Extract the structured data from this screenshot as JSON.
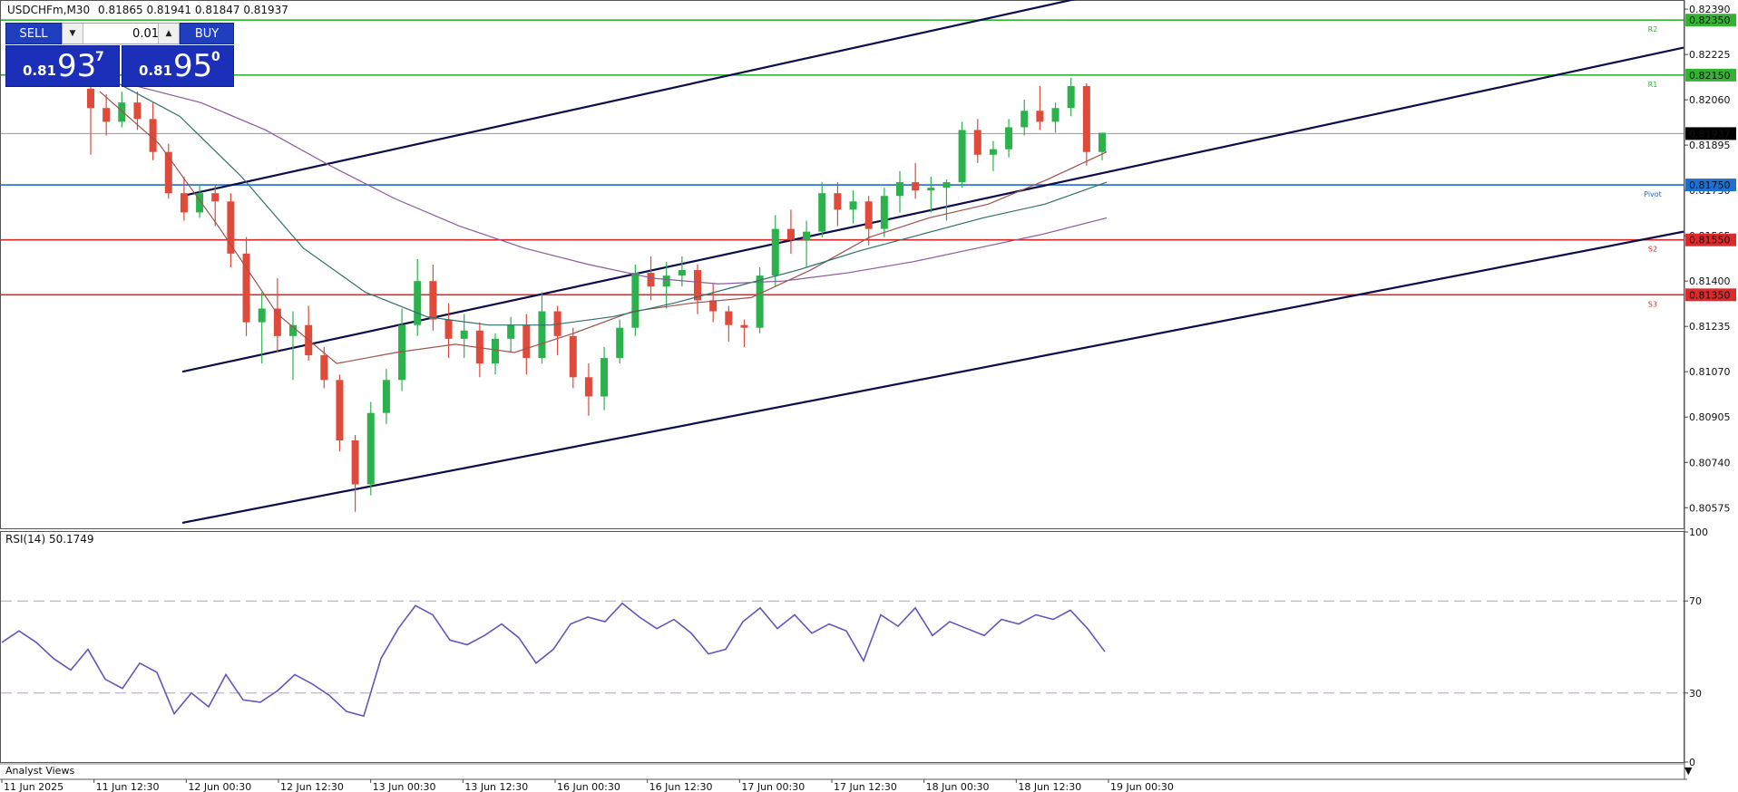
{
  "header": {
    "symbol_info": "USDCHFm,M30",
    "ohlc": "0.81865 0.81941 0.81847 0.81937"
  },
  "trade_panel": {
    "sell_label": "SELL",
    "buy_label": "BUY",
    "lot_value": "0.01",
    "sell_quote": {
      "prefix": "0.81",
      "big": "93",
      "sup": "7"
    },
    "buy_quote": {
      "prefix": "0.81",
      "big": "95",
      "sup": "0"
    }
  },
  "chart_data": [
    {
      "type": "candlestick",
      "title": "USDCHFm,M30",
      "y_ticks": [
        "0.82390",
        "0.82225",
        "0.82060",
        "0.81895",
        "0.81730",
        "0.81565",
        "0.81400",
        "0.81235",
        "0.81070",
        "0.80905",
        "0.80740",
        "0.80575"
      ],
      "ylim": [
        0.805,
        0.8242
      ],
      "x_tick_labels": [
        "11 Jun 2025",
        "11 Jun 12:30",
        "12 Jun 00:30",
        "12 Jun 12:30",
        "13 Jun 00:30",
        "13 Jun 12:30",
        "16 Jun 00:30",
        "16 Jun 12:30",
        "17 Jun 00:30",
        "17 Jun 12:30",
        "18 Jun 00:30",
        "18 Jun 12:30",
        "19 Jun 00:30"
      ],
      "current_price": {
        "value": 0.81937,
        "label": "0.81937",
        "color": "#000000"
      },
      "pivot_levels": [
        {
          "name": "R2",
          "value": 0.8235,
          "label": "0.82350",
          "color": "#33b233"
        },
        {
          "name": "R1",
          "value": 0.8215,
          "label": "0.82150",
          "color": "#33b233"
        },
        {
          "name": "Pivot",
          "value": 0.8175,
          "label": "0.81750",
          "color": "#1e6fd0"
        },
        {
          "name": "S2",
          "value": 0.8155,
          "label": "0.81550",
          "color": "#d92b2b"
        },
        {
          "name": "S3",
          "value": 0.8135,
          "label": "0.81350",
          "color": "#d92b2b"
        }
      ],
      "trend_channel": [
        {
          "from": {
            "x": 0.172,
            "y": 0.8171
          },
          "to": {
            "x": 0.641,
            "y": 0.8243
          }
        },
        {
          "from": {
            "x": 0.172,
            "y": 0.8107
          },
          "to": {
            "x": 1.0,
            "y": 0.8225
          }
        },
        {
          "from": {
            "x": 0.172,
            "y": 0.8052
          },
          "to": {
            "x": 1.0,
            "y": 0.8158
          }
        }
      ],
      "candles": [
        [
          0.821,
          0.8218,
          0.8186,
          0.8203
        ],
        [
          0.8203,
          0.8208,
          0.8193,
          0.8198
        ],
        [
          0.8198,
          0.8209,
          0.8196,
          0.8205
        ],
        [
          0.8205,
          0.8209,
          0.8195,
          0.8199
        ],
        [
          0.8199,
          0.8205,
          0.8184,
          0.8187
        ],
        [
          0.8187,
          0.819,
          0.817,
          0.8172
        ],
        [
          0.8172,
          0.8178,
          0.8162,
          0.8165
        ],
        [
          0.8165,
          0.8175,
          0.8163,
          0.8172
        ],
        [
          0.8172,
          0.8175,
          0.816,
          0.8169
        ],
        [
          0.8169,
          0.8172,
          0.8145,
          0.815
        ],
        [
          0.815,
          0.8156,
          0.812,
          0.8125
        ],
        [
          0.8125,
          0.8136,
          0.811,
          0.813
        ],
        [
          0.813,
          0.8141,
          0.8114,
          0.812
        ],
        [
          0.812,
          0.8129,
          0.8104,
          0.8124
        ],
        [
          0.8124,
          0.8131,
          0.8111,
          0.8113
        ],
        [
          0.8113,
          0.8116,
          0.8101,
          0.8104
        ],
        [
          0.8104,
          0.8106,
          0.8078,
          0.8082
        ],
        [
          0.8082,
          0.8084,
          0.8056,
          0.8066
        ],
        [
          0.8066,
          0.8096,
          0.8062,
          0.8092
        ],
        [
          0.8092,
          0.8108,
          0.8088,
          0.8104
        ],
        [
          0.8104,
          0.813,
          0.81,
          0.8124
        ],
        [
          0.8124,
          0.8148,
          0.812,
          0.814
        ],
        [
          0.814,
          0.8146,
          0.8122,
          0.8126
        ],
        [
          0.8126,
          0.8132,
          0.8112,
          0.8119
        ],
        [
          0.8119,
          0.8128,
          0.8112,
          0.8122
        ],
        [
          0.8122,
          0.8125,
          0.8105,
          0.811
        ],
        [
          0.811,
          0.8121,
          0.8106,
          0.8119
        ],
        [
          0.8119,
          0.8127,
          0.8114,
          0.8124
        ],
        [
          0.8124,
          0.8128,
          0.8106,
          0.8112
        ],
        [
          0.8112,
          0.8136,
          0.811,
          0.8129
        ],
        [
          0.8129,
          0.8131,
          0.8113,
          0.812
        ],
        [
          0.812,
          0.8123,
          0.8101,
          0.8105
        ],
        [
          0.8105,
          0.811,
          0.8091,
          0.8098
        ],
        [
          0.8098,
          0.8116,
          0.8093,
          0.8112
        ],
        [
          0.8112,
          0.8126,
          0.811,
          0.8123
        ],
        [
          0.8123,
          0.8146,
          0.812,
          0.8143
        ],
        [
          0.8143,
          0.8149,
          0.8133,
          0.8138
        ],
        [
          0.8138,
          0.8147,
          0.813,
          0.8142
        ],
        [
          0.8142,
          0.8149,
          0.8138,
          0.8144
        ],
        [
          0.8144,
          0.8146,
          0.8128,
          0.8133
        ],
        [
          0.8133,
          0.8139,
          0.8125,
          0.8129
        ],
        [
          0.8129,
          0.8131,
          0.8118,
          0.8124
        ],
        [
          0.8124,
          0.8126,
          0.8116,
          0.8123
        ],
        [
          0.8123,
          0.8145,
          0.8121,
          0.8142
        ],
        [
          0.8142,
          0.8164,
          0.8138,
          0.8159
        ],
        [
          0.8159,
          0.8166,
          0.815,
          0.8155
        ],
        [
          0.8155,
          0.8162,
          0.8145,
          0.8158
        ],
        [
          0.8158,
          0.8176,
          0.8156,
          0.8172
        ],
        [
          0.8172,
          0.8176,
          0.816,
          0.8166
        ],
        [
          0.8166,
          0.8173,
          0.8161,
          0.8169
        ],
        [
          0.8169,
          0.8171,
          0.8153,
          0.8159
        ],
        [
          0.8159,
          0.8174,
          0.8156,
          0.8171
        ],
        [
          0.8171,
          0.818,
          0.8165,
          0.8176
        ],
        [
          0.8176,
          0.8183,
          0.817,
          0.8173
        ],
        [
          0.8173,
          0.8178,
          0.8165,
          0.8174
        ],
        [
          0.8174,
          0.8177,
          0.8162,
          0.8176
        ],
        [
          0.8176,
          0.8198,
          0.8174,
          0.8195
        ],
        [
          0.8195,
          0.8199,
          0.8183,
          0.8186
        ],
        [
          0.8186,
          0.8191,
          0.818,
          0.8188
        ],
        [
          0.8188,
          0.8199,
          0.8185,
          0.8196
        ],
        [
          0.8196,
          0.8206,
          0.8193,
          0.8202
        ],
        [
          0.8202,
          0.8211,
          0.8195,
          0.8198
        ],
        [
          0.8198,
          0.8205,
          0.8194,
          0.8203
        ],
        [
          0.8203,
          0.8214,
          0.82,
          0.8211
        ],
        [
          0.8211,
          0.8212,
          0.8182,
          0.8187
        ],
        [
          0.8187,
          0.8194,
          0.8184,
          0.8194
        ]
      ],
      "moving_averages": [
        {
          "color": "#a0524d",
          "values": [
            0.8209,
            0.819,
            0.816,
            0.8128,
            0.811,
            0.8114,
            0.8117,
            0.8114,
            0.8121,
            0.8129,
            0.8132,
            0.8134,
            0.8144,
            0.8156,
            0.8163,
            0.8168,
            0.8177,
            0.8187
          ]
        },
        {
          "color": "#2f6f6a",
          "values": [
            0.8212,
            0.82,
            0.8178,
            0.8152,
            0.8136,
            0.8127,
            0.8124,
            0.8124,
            0.8127,
            0.8132,
            0.8138,
            0.8144,
            0.8151,
            0.8157,
            0.8163,
            0.8168,
            0.8176
          ]
        },
        {
          "color": "#8a5a9a",
          "values": [
            0.8211,
            0.8205,
            0.8195,
            0.8182,
            0.817,
            0.816,
            0.8152,
            0.8146,
            0.8141,
            0.8139,
            0.814,
            0.8143,
            0.8147,
            0.8152,
            0.8157,
            0.8163
          ]
        }
      ]
    },
    {
      "type": "line",
      "title": "RSI(14) 50.1749",
      "y_ticks": [
        "100",
        "70",
        "30",
        "0"
      ],
      "ylim": [
        0,
        100
      ],
      "levels": [
        70,
        30
      ],
      "series": [
        {
          "name": "RSI(14)",
          "color": "#6655bb",
          "values": [
            52,
            57,
            52,
            45,
            40,
            49,
            36,
            32,
            43,
            39,
            21,
            30,
            24,
            38,
            27,
            26,
            31,
            38,
            34,
            29,
            22,
            20,
            45,
            58,
            68,
            64,
            53,
            51,
            55,
            60,
            54,
            43,
            49,
            60,
            63,
            61,
            69,
            63,
            58,
            62,
            56,
            47,
            49,
            61,
            67,
            58,
            64,
            56,
            60,
            57,
            44,
            64,
            59,
            67,
            55,
            61,
            58,
            55,
            62,
            60,
            64,
            62,
            66,
            58,
            48
          ]
        }
      ]
    }
  ],
  "footer": {
    "analyst_views_label": "Analyst Views"
  }
}
